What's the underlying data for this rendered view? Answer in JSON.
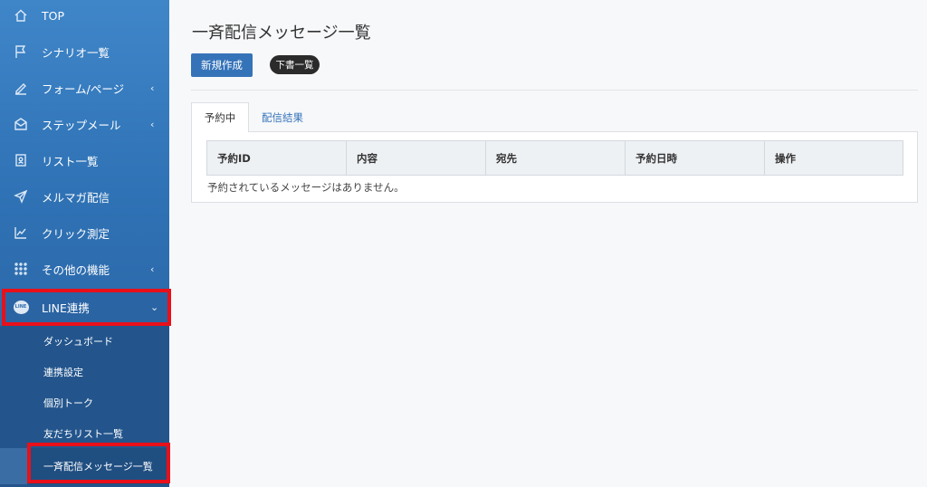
{
  "sidebar": {
    "items": [
      {
        "label": "TOP",
        "icon": "home-icon"
      },
      {
        "label": "シナリオ一覧",
        "icon": "flag-icon"
      },
      {
        "label": "フォーム/ページ",
        "icon": "pen-icon",
        "chevron": "‹"
      },
      {
        "label": "ステップメール",
        "icon": "mail-icon",
        "chevron": "‹"
      },
      {
        "label": "リスト一覧",
        "icon": "contact-icon"
      },
      {
        "label": "メルマガ配信",
        "icon": "send-icon"
      },
      {
        "label": "クリック測定",
        "icon": "chart-icon"
      },
      {
        "label": "その他の機能",
        "icon": "grid-icon",
        "chevron": "‹"
      },
      {
        "label": "LINE連携",
        "icon": "line-icon",
        "chevron": "⌄",
        "badge": "LINE"
      }
    ],
    "submenu": [
      {
        "label": "ダッシュボード"
      },
      {
        "label": "連携設定"
      },
      {
        "label": "個別トーク"
      },
      {
        "label": "友だちリスト一覧"
      },
      {
        "label": "一斉配信メッセージ一覧"
      }
    ]
  },
  "main": {
    "title": "一斉配信メッセージ一覧",
    "new_button": "新規作成",
    "draft_button": "下書一覧",
    "tabs": [
      {
        "label": "予約中"
      },
      {
        "label": "配信結果"
      }
    ],
    "table": {
      "columns": [
        "予約ID",
        "内容",
        "宛先",
        "予約日時",
        "操作"
      ],
      "empty_message": "予約されているメッセージはありません。"
    }
  }
}
